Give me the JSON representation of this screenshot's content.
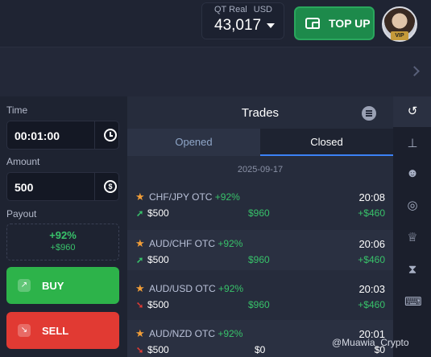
{
  "header": {
    "account_type": "QT Real",
    "currency": "USD",
    "balance": "43,017",
    "topup_label": "TOP UP",
    "vip_label": "VIP"
  },
  "left_panel": {
    "time_label": "Time",
    "time_value": "00:01:00",
    "amount_label": "Amount",
    "amount_value": "500",
    "payout_label": "Payout",
    "payout_percent": "+92%",
    "payout_amount": "+$960",
    "buy_label": "BUY",
    "sell_label": "SELL"
  },
  "trades": {
    "title": "Trades",
    "tabs": {
      "opened": "Opened",
      "closed": "Closed"
    },
    "active_tab": "Closed",
    "date": "2025-09-17",
    "items": [
      {
        "pair": "CHF/JPY OTC",
        "percent": "+92%",
        "time": "20:08",
        "direction": "up",
        "stake": "$500",
        "payout": "$960",
        "profit": "+$460"
      },
      {
        "pair": "AUD/CHF OTC",
        "percent": "+92%",
        "time": "20:06",
        "direction": "up",
        "stake": "$500",
        "payout": "$960",
        "profit": "+$460"
      },
      {
        "pair": "AUD/USD OTC",
        "percent": "+92%",
        "time": "20:03",
        "direction": "down",
        "stake": "$500",
        "payout": "$960",
        "profit": "+$460"
      },
      {
        "pair": "AUD/NZD OTC",
        "percent": "+92%",
        "time": "20:01",
        "direction": "down",
        "stake": "$500",
        "payout": "$0",
        "profit": "$0"
      }
    ]
  },
  "right_bar": {
    "icons": [
      "history-icon",
      "signals-icon",
      "social-trading-icon",
      "target-icon",
      "trophy-icon",
      "hourglass-icon",
      "keyboard-icon"
    ]
  },
  "watermark": "@Muawia_Crypto",
  "colors": {
    "green": "#38c26a",
    "red": "#e13a33",
    "accent_blue": "#3b82f6",
    "star": "#f29e38"
  }
}
